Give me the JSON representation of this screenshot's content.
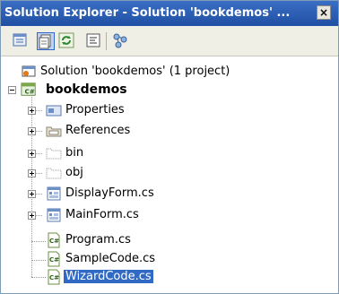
{
  "window": {
    "title": "Solution Explorer - Solution 'bookdemos' ...",
    "close_glyph": "×"
  },
  "toolbar": {
    "buttons": [
      {
        "name": "properties-icon",
        "active": false
      },
      {
        "name": "show-all-files-icon",
        "active": true
      },
      {
        "name": "refresh-icon",
        "active": false
      },
      {
        "name": "view-code-icon",
        "active": false
      },
      {
        "name": "class-diagram-icon",
        "active": false
      }
    ]
  },
  "tree": {
    "solution": {
      "label": "Solution 'bookdemos' (1 project)",
      "icon": "solution-icon"
    },
    "project": {
      "label": "bookdemos",
      "icon": "csharp-project-icon"
    },
    "items": [
      {
        "label": "Properties",
        "icon": "properties-folder-icon",
        "expandable": true
      },
      {
        "label": "References",
        "icon": "references-folder-icon",
        "expandable": true
      },
      {
        "label": "bin",
        "icon": "folder-icon",
        "expandable": true
      },
      {
        "label": "obj",
        "icon": "folder-icon",
        "expandable": true
      },
      {
        "label": "DisplayForm.cs",
        "icon": "form-icon",
        "expandable": true
      },
      {
        "label": "MainForm.cs",
        "icon": "form-icon",
        "expandable": true
      },
      {
        "label": "Program.cs",
        "icon": "csharp-file-icon",
        "expandable": false
      },
      {
        "label": "SampleCode.cs",
        "icon": "csharp-file-icon",
        "expandable": false
      },
      {
        "label": "WizardCode.cs",
        "icon": "csharp-file-icon",
        "expandable": false,
        "selected": true
      }
    ]
  }
}
